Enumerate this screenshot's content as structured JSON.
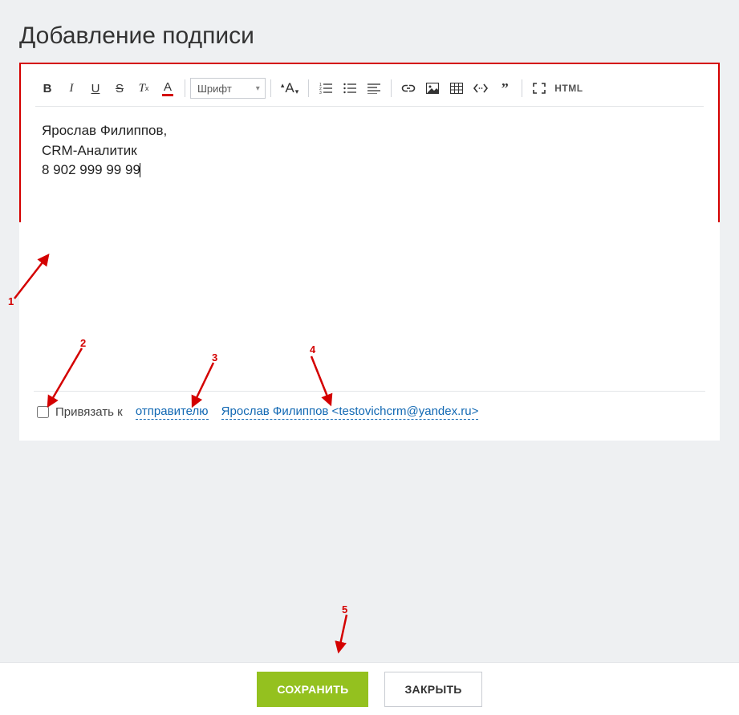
{
  "title": "Добавление подписи",
  "toolbar": {
    "font_label": "Шрифт",
    "html_label": "HTML"
  },
  "signature": {
    "line1": "Ярослав Филиппов,",
    "line2": "CRM-Аналитик",
    "line3": "8 902 999 99 99"
  },
  "bind": {
    "label": "Привязать к",
    "sender_link": "отправителю",
    "address_link": "Ярослав Филиппов <testovichcrm@yandex.ru>"
  },
  "footer": {
    "save": "СОХРАНИТЬ",
    "close": "ЗАКРЫТЬ"
  },
  "annotations": {
    "n1": "1",
    "n2": "2",
    "n3": "3",
    "n4": "4",
    "n5": "5"
  }
}
